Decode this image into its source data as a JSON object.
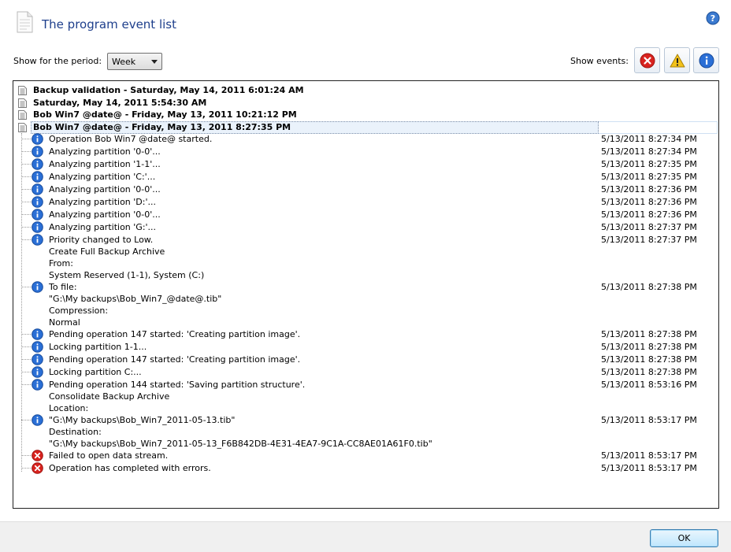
{
  "header": {
    "title": "The program event list",
    "icon": "document-icon",
    "help_icon": "help-icon"
  },
  "toolbar": {
    "period_label": "Show for the period:",
    "period_value": "Week",
    "events_label": "Show events:",
    "filter_buttons": [
      "error-icon",
      "warning-icon",
      "info-icon"
    ]
  },
  "sessions": [
    {
      "label": "Backup validation - Saturday, May 14, 2011 6:01:24 AM",
      "expanded": false
    },
    {
      "label": "Saturday, May 14, 2011 5:54:30 AM",
      "expanded": false
    },
    {
      "label": "Bob Win7 @date@ - Friday, May 13, 2011 10:21:12 PM",
      "expanded": false
    },
    {
      "label": "Bob Win7 @date@ - Friday, May 13, 2011 8:27:35 PM",
      "expanded": true,
      "selected": true
    }
  ],
  "events": [
    {
      "type": "info",
      "lines": [
        "Operation Bob Win7 @date@ started."
      ],
      "time": "5/13/2011 8:27:34 PM"
    },
    {
      "type": "info",
      "lines": [
        "Analyzing partition '0-0'..."
      ],
      "time": "5/13/2011 8:27:34 PM"
    },
    {
      "type": "info",
      "lines": [
        "Analyzing partition '1-1'..."
      ],
      "time": "5/13/2011 8:27:35 PM"
    },
    {
      "type": "info",
      "lines": [
        "Analyzing partition 'C:'..."
      ],
      "time": "5/13/2011 8:27:35 PM"
    },
    {
      "type": "info",
      "lines": [
        "Analyzing partition '0-0'..."
      ],
      "time": "5/13/2011 8:27:36 PM"
    },
    {
      "type": "info",
      "lines": [
        "Analyzing partition 'D:'..."
      ],
      "time": "5/13/2011 8:27:36 PM"
    },
    {
      "type": "info",
      "lines": [
        "Analyzing partition '0-0'..."
      ],
      "time": "5/13/2011 8:27:36 PM"
    },
    {
      "type": "info",
      "lines": [
        "Analyzing partition 'G:'..."
      ],
      "time": "5/13/2011 8:27:37 PM"
    },
    {
      "type": "info",
      "lines": [
        "Priority changed to Low.",
        "Create Full Backup Archive",
        "From:",
        "System Reserved (1-1), System (C:)"
      ],
      "time": "5/13/2011 8:27:37 PM"
    },
    {
      "type": "info",
      "lines": [
        "To file:",
        "\"G:\\My backups\\Bob_Win7_@date@.tib\"",
        "Compression:",
        "Normal"
      ],
      "time": "5/13/2011 8:27:38 PM"
    },
    {
      "type": "info",
      "lines": [
        "Pending operation 147 started: 'Creating partition image'."
      ],
      "time": "5/13/2011 8:27:38 PM"
    },
    {
      "type": "info",
      "lines": [
        "Locking partition 1-1..."
      ],
      "time": "5/13/2011 8:27:38 PM"
    },
    {
      "type": "info",
      "lines": [
        "Pending operation 147 started: 'Creating partition image'."
      ],
      "time": "5/13/2011 8:27:38 PM"
    },
    {
      "type": "info",
      "lines": [
        "Locking partition C:..."
      ],
      "time": "5/13/2011 8:27:38 PM"
    },
    {
      "type": "info",
      "lines": [
        "Pending operation 144 started: 'Saving partition structure'.",
        "Consolidate Backup Archive",
        "Location:"
      ],
      "time": "5/13/2011 8:53:16 PM"
    },
    {
      "type": "info",
      "lines": [
        "\"G:\\My backups\\Bob_Win7_2011-05-13.tib\"",
        "Destination:",
        "\"G:\\My backups\\Bob_Win7_2011-05-13_F6B842DB-4E31-4EA7-9C1A-CC8AE01A61F0.tib\""
      ],
      "time": "5/13/2011 8:53:17 PM"
    },
    {
      "type": "error",
      "lines": [
        "Failed to open data stream."
      ],
      "time": "5/13/2011 8:53:17 PM"
    },
    {
      "type": "error",
      "lines": [
        "Operation has completed with errors."
      ],
      "time": "5/13/2011 8:53:17 PM"
    }
  ],
  "footer": {
    "ok_label": "OK"
  },
  "colors": {
    "title": "#1e3f8c",
    "info": "#2a6fd6",
    "error": "#d8231f",
    "warning": "#f2c21b"
  }
}
